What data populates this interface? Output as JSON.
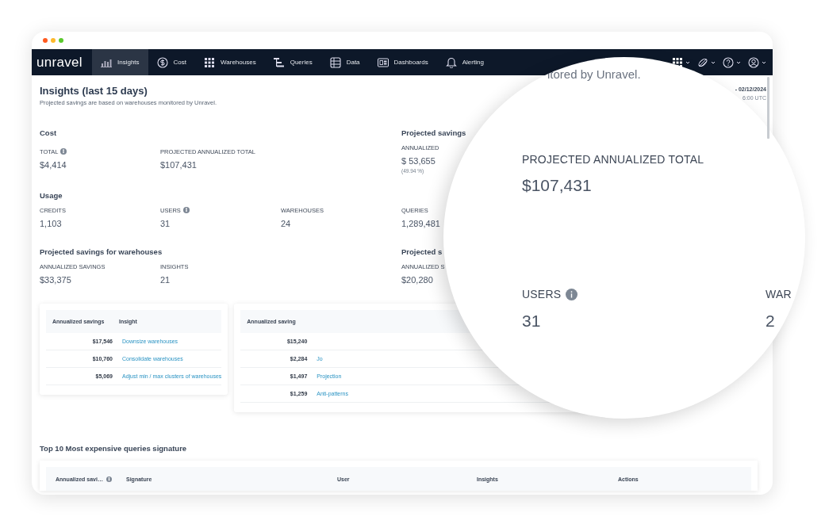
{
  "window": {
    "dots": [
      {
        "color": "#ff5a1f"
      },
      {
        "color": "#fdb92c"
      },
      {
        "color": "#5ac92c"
      }
    ]
  },
  "nav": {
    "logo": "unravel",
    "items": [
      {
        "label": "Insights",
        "selected": true
      },
      {
        "label": "Cost",
        "selected": false
      },
      {
        "label": "Warehouses",
        "selected": false
      },
      {
        "label": "Queries",
        "selected": false
      },
      {
        "label": "Data",
        "selected": false
      },
      {
        "label": "Dashboards",
        "selected": false
      },
      {
        "label": "Alerting",
        "selected": false
      }
    ]
  },
  "header": {
    "title": "Insights (last 15 days)",
    "subtitle": "Projected savings are based on warehouses monitored by Unravel.",
    "date_range": "- 02/12/2024",
    "date_time": "6:00 UTC"
  },
  "rows": [
    {
      "groups": [
        {
          "title": "Cost",
          "stats": [
            {
              "label": "TOTAL",
              "info": true,
              "value": "$4,414"
            },
            {
              "label": "PROJECTED ANNUALIZED TOTAL",
              "info": false,
              "value": "$107,431"
            }
          ]
        },
        {
          "title": "Projected savings",
          "stats": [
            {
              "label": "ANNUALIZED",
              "info": false,
              "value": "$ 53,655",
              "note": "(49.94 %)"
            }
          ]
        }
      ]
    },
    {
      "groups": [
        {
          "title": "Usage",
          "stats": [
            {
              "label": "CREDITS",
              "info": false,
              "value": "1,103"
            },
            {
              "label": "USERS",
              "info": true,
              "value": "31"
            },
            {
              "label": "WAREHOUSES",
              "info": false,
              "value": "24"
            },
            {
              "label": "QUERIES",
              "info": false,
              "value": "1,289,481"
            }
          ]
        }
      ]
    },
    {
      "groups": [
        {
          "title": "Projected savings for warehouses",
          "stats": [
            {
              "label": "ANNUALIZED SAVINGS",
              "info": false,
              "value": "$33,375"
            },
            {
              "label": "INSIGHTS",
              "info": false,
              "value": "21"
            }
          ]
        },
        {
          "title": "Projected s",
          "stats": [
            {
              "label": "ANNUALIZED S",
              "info": false,
              "value": "$20,280"
            }
          ]
        }
      ]
    }
  ],
  "tables": [
    {
      "columns": [
        "Annualized savings",
        "Insight"
      ],
      "rows": [
        {
          "savings": "$17,546",
          "insight": "Downsize warehouses"
        },
        {
          "savings": "$10,760",
          "insight": "Consolidate warehouses"
        },
        {
          "savings": "$5,069",
          "insight": "Adjust min / max clusters of warehouses"
        }
      ]
    },
    {
      "columns": [
        "Annualized saving"
      ],
      "rows": [
        {
          "savings": "$15,240"
        },
        {
          "savings": "$2,284",
          "insight": "Jo"
        },
        {
          "savings": "$1,497",
          "insight": "Projection"
        },
        {
          "savings": "$1,259",
          "insight": "Anti-patterns"
        }
      ]
    }
  ],
  "queries": {
    "title": "Top 10 Most expensive queries signature",
    "columns": [
      {
        "label": "Annualized savi…",
        "info": true
      },
      {
        "label": "Signature",
        "info": false
      },
      {
        "label": "User",
        "info": false
      },
      {
        "label": "Insights",
        "info": false
      },
      {
        "label": "Actions",
        "info": false
      }
    ]
  },
  "magnifier": {
    "fragment": "itored by Unravel.",
    "stats": [
      {
        "label": "PROJECTED ANNUALIZED TOTAL",
        "info": false,
        "value": "$107,431"
      },
      {
        "label": "USERS",
        "info": true,
        "value": "31"
      },
      {
        "label": "WAR",
        "info": false,
        "value": "2"
      }
    ]
  }
}
